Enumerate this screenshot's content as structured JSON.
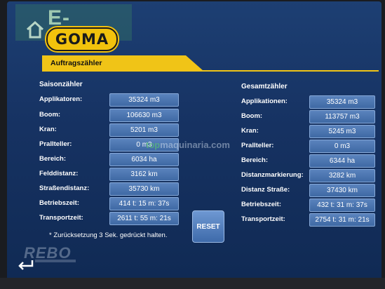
{
  "watermarks": {
    "efarm": "E-FARM",
    "topmaquinaria_brand": "top",
    "topmaquinaria_rest": "maquinaria.com",
    "rebo": "REBO"
  },
  "logo": {
    "text": "GOMA"
  },
  "title": "Auftragszähler",
  "season": {
    "heading": "Saisonzähler",
    "rows": [
      {
        "label": "Applikatoren:",
        "value": "35324 m3"
      },
      {
        "label": "Boom:",
        "value": "106630 m3"
      },
      {
        "label": "Kran:",
        "value": "5201 m3"
      },
      {
        "label": "Prallteller:",
        "value": "0 m3"
      },
      {
        "label": "Bereich:",
        "value": "6034 ha"
      },
      {
        "label": "Felddistanz:",
        "value": "3162 km"
      },
      {
        "label": "Straßendistanz:",
        "value": "35730 km"
      },
      {
        "label": "Betriebszeit:",
        "value": "414 t: 15 m: 37s"
      },
      {
        "label": "Transportzeit:",
        "value": "2611 t: 55 m: 21s"
      }
    ]
  },
  "total": {
    "heading": "Gesamtzähler",
    "rows": [
      {
        "label": "Applikationen:",
        "value": "35324 m3"
      },
      {
        "label": "Boom:",
        "value": "113757 m3"
      },
      {
        "label": "Kran:",
        "value": "5245 m3"
      },
      {
        "label": "Prallteller:",
        "value": "0 m3"
      },
      {
        "label": "Bereich:",
        "value": "6344 ha"
      },
      {
        "label": "Distanzmarkierung:",
        "value": "3282 km"
      },
      {
        "label": "Distanz Straße:",
        "value": "37430 km"
      },
      {
        "label": "Betriebszeit:",
        "value": "432 t: 31 m: 37s"
      },
      {
        "label": "Transportzeit:",
        "value": "2754 t: 31 m: 21s"
      }
    ]
  },
  "note": "* Zurücksetzung 3 Sek. gedrückt halten.",
  "reset_label": "RESET",
  "icons": {
    "back": "back-arrow-icon",
    "home": "house-icon"
  },
  "colors": {
    "accent": "#f0c417",
    "background": "#163262",
    "value_box": "#4a74b0"
  }
}
